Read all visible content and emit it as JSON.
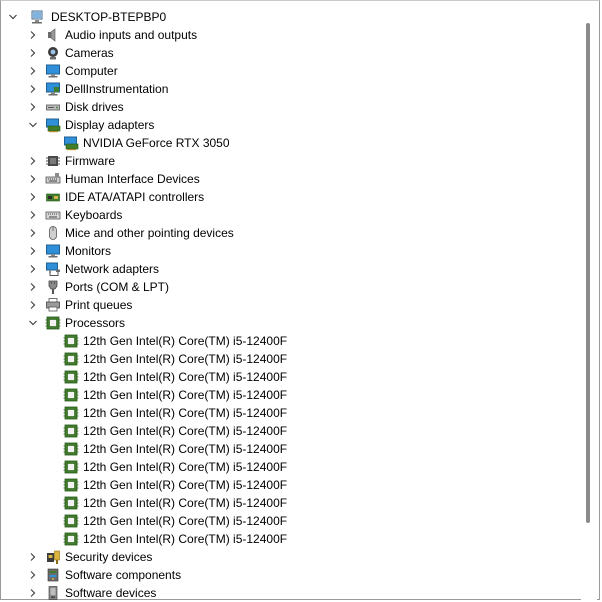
{
  "root": {
    "label": "DESKTOP-BTEPBP0"
  },
  "categories": [
    {
      "label": "Audio inputs and outputs",
      "icon": "speaker-icon"
    },
    {
      "label": "Cameras",
      "icon": "camera-icon"
    },
    {
      "label": "Computer",
      "icon": "computer-icon"
    },
    {
      "label": "DellInstrumentation",
      "icon": "monitor-chip-icon"
    },
    {
      "label": "Disk drives",
      "icon": "disk-drive-icon"
    },
    {
      "label": "Display adapters",
      "icon": "display-adapter-icon",
      "expanded": true,
      "children": [
        {
          "label": "NVIDIA GeForce RTX 3050",
          "icon": "display-adapter-icon"
        }
      ]
    },
    {
      "label": "Firmware",
      "icon": "chip-icon"
    },
    {
      "label": "Human Interface Devices",
      "icon": "hid-icon"
    },
    {
      "label": "IDE ATA/ATAPI controllers",
      "icon": "controller-icon"
    },
    {
      "label": "Keyboards",
      "icon": "keyboard-icon"
    },
    {
      "label": "Mice and other pointing devices",
      "icon": "mouse-icon"
    },
    {
      "label": "Monitors",
      "icon": "monitor-icon"
    },
    {
      "label": "Network adapters",
      "icon": "network-icon"
    },
    {
      "label": "Ports (COM & LPT)",
      "icon": "port-icon"
    },
    {
      "label": "Print queues",
      "icon": "printer-icon"
    },
    {
      "label": "Processors",
      "icon": "processor-icon",
      "expanded": true,
      "children": [
        {
          "label": "12th Gen Intel(R) Core(TM) i5-12400F",
          "icon": "processor-icon"
        },
        {
          "label": "12th Gen Intel(R) Core(TM) i5-12400F",
          "icon": "processor-icon"
        },
        {
          "label": "12th Gen Intel(R) Core(TM) i5-12400F",
          "icon": "processor-icon"
        },
        {
          "label": "12th Gen Intel(R) Core(TM) i5-12400F",
          "icon": "processor-icon"
        },
        {
          "label": "12th Gen Intel(R) Core(TM) i5-12400F",
          "icon": "processor-icon"
        },
        {
          "label": "12th Gen Intel(R) Core(TM) i5-12400F",
          "icon": "processor-icon"
        },
        {
          "label": "12th Gen Intel(R) Core(TM) i5-12400F",
          "icon": "processor-icon"
        },
        {
          "label": "12th Gen Intel(R) Core(TM) i5-12400F",
          "icon": "processor-icon"
        },
        {
          "label": "12th Gen Intel(R) Core(TM) i5-12400F",
          "icon": "processor-icon"
        },
        {
          "label": "12th Gen Intel(R) Core(TM) i5-12400F",
          "icon": "processor-icon"
        },
        {
          "label": "12th Gen Intel(R) Core(TM) i5-12400F",
          "icon": "processor-icon"
        },
        {
          "label": "12th Gen Intel(R) Core(TM) i5-12400F",
          "icon": "processor-icon"
        }
      ]
    },
    {
      "label": "Security devices",
      "icon": "security-icon"
    },
    {
      "label": "Software components",
      "icon": "software-component-icon"
    },
    {
      "label": "Software devices",
      "icon": "software-device-icon"
    }
  ],
  "colors": {
    "chip_green": "#3f7d2a",
    "screen_blue": "#2f8fd8",
    "chevron": "#444444"
  }
}
